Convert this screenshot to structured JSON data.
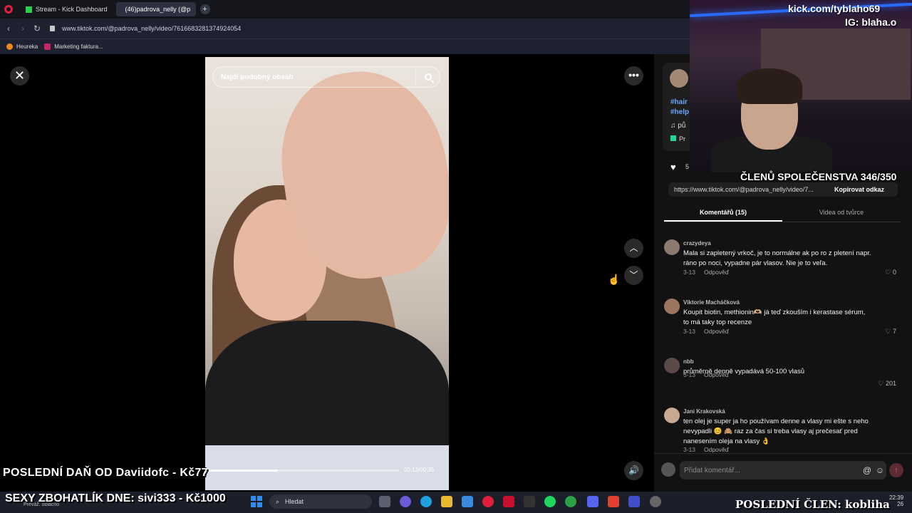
{
  "browser": {
    "tabs": [
      {
        "label": "Stream - Kick Dashboard"
      },
      {
        "label": "(46)padrova_nelly (@p"
      }
    ],
    "new_tab": "+",
    "url": "www.tiktok.com/@padrova_nelly/video/7616683281374924054",
    "bookmarks": [
      "Heureka",
      "Marketing faktura..."
    ]
  },
  "video": {
    "search_placeholder": "Najdi podobný obsah",
    "time": "00:13/00:35",
    "progress": 0.37
  },
  "panel": {
    "hashtag1": "#hair",
    "hashtag2": "#help",
    "music": "♫ pů",
    "promo": "Pr",
    "like_count": "5",
    "link": "https://www.tiktok.com/@padrova_nelly/video/7...",
    "copy_link": "Kopírovat odkaz",
    "tab_comments": "Komentářů (15)",
    "tab_creator": "Videa od tvůrce",
    "reply_label": "Odpověď",
    "comments": [
      {
        "user": "crazydeya",
        "text": "Mala si zapletený vrkoč, je to normálne ak po ro z pletení napr. ráno po noci, vypadne pár vlasov. Nie je to veľa.",
        "date": "3-13",
        "likes": "0",
        "avatar_color": "#8a7a70"
      },
      {
        "user": "Viktorie Macháčková",
        "text": "Koupit biotin, methionin🫶🏼 já teď zkouším i kerastase sérum, to má taky top recenze",
        "date": "3-13",
        "likes": "7",
        "avatar_color": "#9c7560"
      },
      {
        "user": "nbb",
        "text": "průměrně denně vypadává 50-100 vlasů",
        "date": "3-13",
        "likes": "201",
        "avatar_color": "#5a4a48"
      },
      {
        "user": "Jani Krakovská",
        "text": "ten olej je super ja ho používam denne a vlasy mi ešte s neho nevypadli 😊 🙈 raz za čas si treba vlasy aj prečesať pred nanesením oleja na vlasy 👌",
        "date": "3-13",
        "likes": "",
        "avatar_color": "#c8a890"
      }
    ],
    "comment_placeholder": "Přidat komentář..."
  },
  "stream_overlay": {
    "kick_url": "kick.com/tyblaho69",
    "ig": "IG: blaha.o",
    "members": "ČLENŮ SPOLEČENSTVA 346/350",
    "last_tax": "POSLEDNÍ DAŇ OD Daviidofc - Kč77",
    "sexy": "SEXY ZBOHATLÍK DNE: sivi333 - Kč1000",
    "last_member": "POSLEDNÍ ČLEN: kobliha"
  },
  "taskbar": {
    "weather": "Převáž. oblačno",
    "search": "Hledat",
    "time": "22:39",
    "date": "26"
  },
  "colors": {
    "tiktok_red": "#fe2c55",
    "kick_green": "#53fc18",
    "link_blue": "#6aa8ff"
  }
}
